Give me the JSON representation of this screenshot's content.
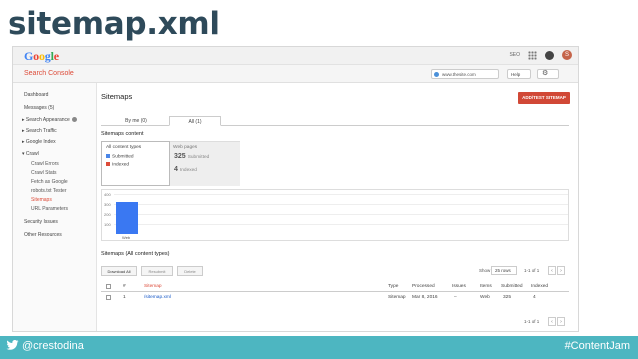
{
  "slide": {
    "title": "sitemap.xml",
    "footer_handle": "@crestodina",
    "footer_tag": "#ContentJam"
  },
  "google_bar": {
    "logo_letters": [
      "G",
      "o",
      "o",
      "g",
      "l",
      "e"
    ],
    "seo_label": "SEO",
    "avatar_initial": "S"
  },
  "console_bar": {
    "title": "Search Console",
    "site": "www.thesite.com",
    "help": "Help",
    "gear": "⚙"
  },
  "sidebar": {
    "items": [
      {
        "label": "Dashboard"
      },
      {
        "label": "Messages (5)"
      },
      {
        "label": "▸ Search Appearance"
      },
      {
        "label": "▸ Search Traffic"
      },
      {
        "label": "▸ Google Index"
      },
      {
        "label": "▾ Crawl"
      },
      {
        "label": "Crawl Errors"
      },
      {
        "label": "Crawl Stats"
      },
      {
        "label": "Fetch as Google"
      },
      {
        "label": "robots.txt Tester"
      },
      {
        "label": "Sitemaps"
      },
      {
        "label": "URL Parameters"
      },
      {
        "label": "Security Issues"
      },
      {
        "label": "Other Resources"
      }
    ]
  },
  "main": {
    "page_title": "Sitemaps",
    "add_button": "ADD/TEST SITEMAP",
    "tabs": [
      {
        "label": "By me (0)"
      },
      {
        "label": "All (1)"
      }
    ],
    "section_title": "Sitemaps content",
    "content_types": {
      "header": "All content types",
      "submitted": "Submitted",
      "indexed": "Indexed",
      "submitted_color": "#4a86e8",
      "indexed_color": "#dd4b39"
    },
    "web_pages": {
      "label": "Web pages",
      "submitted_value": "325",
      "submitted_label": "Submitted",
      "indexed_value": "4",
      "indexed_label": "Indexed"
    },
    "table_title": "Sitemaps (All content types)",
    "buttons": {
      "download": "Download All",
      "resubmit": "Resubmit",
      "delete": "Delete"
    },
    "pager": {
      "show": "Show",
      "rows": "25 rows",
      "range_top": "1-1 of 1",
      "range_bottom": "1-1 of 1"
    },
    "columns": [
      "#",
      "Sitemap",
      "Type",
      "Processed",
      "Issues",
      "Items",
      "Submitted",
      "Indexed"
    ],
    "rows": [
      {
        "num": "1",
        "sitemap": "/sitemap.xml",
        "type": "Sitemap",
        "processed": "Mar 8, 2016",
        "issues": "–",
        "items": "Web",
        "submitted": "325",
        "indexed": "4"
      }
    ]
  },
  "chart_data": {
    "type": "bar",
    "categories": [
      "Web"
    ],
    "series": [
      {
        "values": [
          325
        ],
        "color": "#3a78f2"
      }
    ],
    "yticks": [
      "400",
      "300",
      "200",
      "100"
    ],
    "ylim": [
      0,
      400
    ],
    "title": "",
    "xlabel": "",
    "ylabel": ""
  }
}
